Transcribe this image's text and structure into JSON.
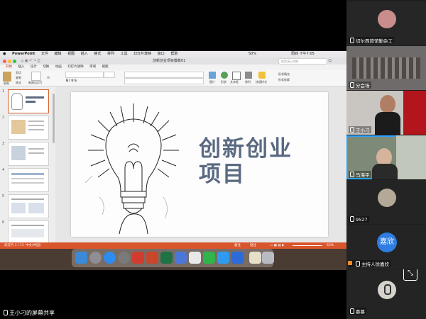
{
  "mac_menubar": {
    "items": [
      "PowerPoint",
      "文件",
      "编辑",
      "视图",
      "插入",
      "格式",
      "排列",
      "工具",
      "幻灯片放映",
      "窗口",
      "帮助"
    ],
    "battery": "50%",
    "clock": "周四 下午7:05"
  },
  "ppt_window": {
    "title": "创新创业项目模板01",
    "search_placeholder": "搜索演示文稿",
    "ribbon_tabs": [
      "开始",
      "插入",
      "设计",
      "切换",
      "动画",
      "幻灯片放映",
      "审阅",
      "视图"
    ],
    "ribbon_labels": {
      "paste": "粘贴",
      "cut": "剪切",
      "copy": "复制",
      "format": "格式",
      "new_slide": "新建幻灯片",
      "section": "节",
      "picture": "图片",
      "shape": "形状",
      "textbox": "文本框",
      "arrange": "排列",
      "quick_styles": "快速样式",
      "shape_fill": "形状填充",
      "shape_outline": "形状轮廓"
    }
  },
  "slides": {
    "numbers": [
      "1",
      "2",
      "3",
      "4",
      "5",
      "6"
    ],
    "current_title": "创新创业\n项目"
  },
  "status_bar": {
    "left": "幻灯片 1 / 11",
    "lang": "中文(中国)",
    "notes": "备注",
    "comments": "批注",
    "zoom": "63%"
  },
  "screen_share_label": "王小刁的屏幕共享",
  "participants": [
    {
      "name": "切尔西旅馆勤杂工",
      "muted": true
    },
    {
      "name": "分会场",
      "muted": true
    },
    {
      "name": "王小刁",
      "muted": true
    },
    {
      "name": "马海平",
      "muted": false,
      "active": true
    },
    {
      "name": "9527",
      "muted": true
    },
    {
      "name": "主持人徐嘉欣",
      "muted": true,
      "avatar_text": "嘉欣"
    },
    {
      "name": "慕慕",
      "muted": true
    }
  ],
  "colors": {
    "ppt_accent": "#d6632f",
    "slide_title": "#5b6a82",
    "active_speaker": "#29a3ff",
    "host_avatar": "#2f7de1"
  }
}
